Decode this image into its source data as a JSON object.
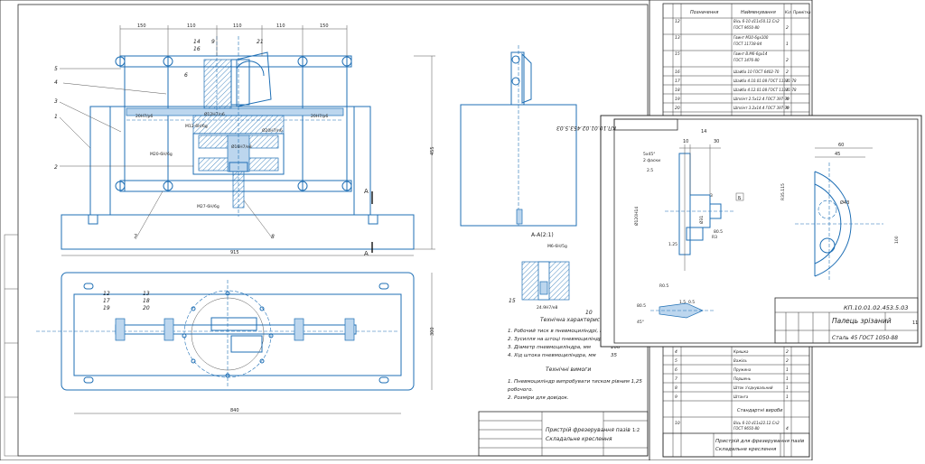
{
  "main_sheet": {
    "part_callouts": [
      "1",
      "2",
      "3",
      "4",
      "5",
      "6",
      "7",
      "8",
      "9",
      "14",
      "16",
      "21"
    ],
    "dimensions_top": [
      "150",
      "110",
      "110",
      "110",
      "150"
    ],
    "dimension_overall_width": "915",
    "dimension_bottom_width": "840",
    "dimension_height": "455",
    "dimension_plan_height": "300",
    "fit_labels": [
      "20H7/p6",
      "20H7/p6",
      "M12-6H/6g",
      "M20-6H/6g",
      "M27-6H/6g",
      "Ø12H7/n6",
      "Ø20H7/n6",
      "Ø16H7/e8"
    ],
    "plan_callouts": [
      "12",
      "17",
      "19",
      "13",
      "18",
      "20"
    ],
    "section_marker": "А",
    "section_title": "А-А(2:1)",
    "section_callouts": [
      "15",
      "10"
    ],
    "section_fits": [
      "М6-6Н/5g",
      "24.9Н7/e8"
    ],
    "tech_char_heading": "Технічна характеристика",
    "tech_char_items": [
      "1. Робочий тиск в пневмоциліндрі, МП",
      "2. Зусилля на штоці пневмоциліндра,",
      "3. Діаметр пневмоциліндра, мм",
      "4. Хід штока пневмоциліндра, мм"
    ],
    "tech_char_values": [
      "100",
      "35"
    ],
    "tech_req_heading": "Технічні вимоги",
    "tech_req_items": [
      "1. Пневмоциліндр випробувати тиском рівним 1,25",
      "   робочого.",
      "2. Розміри для довідок."
    ],
    "title_block": {
      "name_line1": "Пристрій фрезерування пазів",
      "name_line2": "Складальне креслення",
      "scale": "1:2"
    }
  },
  "spec_sheet": {
    "headers": [
      "Позначення",
      "Найменування",
      "Кіл.",
      "Примітка"
    ],
    "rows_top": [
      {
        "pos": "12",
        "name": "Вісь 6-10 d11х50.12.Cn2",
        "name2": "ГОСТ 9650-80",
        "qty": "2"
      },
      {
        "pos": "13",
        "name": "Гвинт М10-6gх100",
        "name2": "ГОСТ 11738-84",
        "qty": "1"
      },
      {
        "pos": "15",
        "name": "Гвинт В.М6-6gх14",
        "name2": "ГОСТ 1476-80",
        "qty": "2"
      },
      {
        "pos": "16",
        "name": "Шайба 10 ГОСТ 6402-70",
        "name2": "",
        "qty": "2"
      },
      {
        "pos": "17",
        "name": "Шайба 4.10.01.08 ГОСТ 11371-78",
        "name2": "",
        "qty": "4"
      },
      {
        "pos": "18",
        "name": "Шайба 4.12.01.08 ГОСТ 11371-78",
        "name2": "",
        "qty": "4"
      },
      {
        "pos": "19",
        "name": "Шплінт 2.5х12.4 ГОСТ 397-79",
        "name2": "",
        "qty": "4"
      },
      {
        "pos": "20",
        "name": "Шплінт 3.2х14.4 ГОСТ 397-79",
        "name2": "",
        "qty": "4"
      }
    ],
    "rows_bottom": [
      {
        "pos": "4",
        "name": "Кришка",
        "qty": "2"
      },
      {
        "pos": "5",
        "name": "Важіль",
        "qty": "2"
      },
      {
        "pos": "6",
        "name": "Пружина",
        "qty": "1"
      },
      {
        "pos": "7",
        "name": "Поршень",
        "qty": "1"
      },
      {
        "pos": "8",
        "name": "Шток з'єднувальний",
        "qty": "1"
      },
      {
        "pos": "9",
        "name": "Штанга",
        "qty": "1"
      }
    ],
    "section_std": "Стандартні вироби",
    "std_row": {
      "pos": "10",
      "name": "Вісь 6-10 d11х22.12.Cn2",
      "name2": "ГОСТ 9650-80",
      "qty": "4"
    },
    "title_block": {
      "name_line1": "Пристрій для фрезерування пазів",
      "name_line2": "Складальне креслення"
    }
  },
  "part_sheet": {
    "doc_code_rotated": "КП.10.01.02.453.5.03",
    "dims": [
      "14",
      "10",
      "30",
      "5х45°",
      "2 фаски",
      "Ø120Н14",
      "Ø31",
      "Ø60",
      "Ø40",
      "Ø43",
      "Ø25",
      "Ø42",
      "Ø25",
      "45",
      "60",
      "1.25",
      "2.5",
      "80.5",
      "3",
      "1.5",
      "0.5",
      "Ø4.9",
      "R0.5",
      "R3",
      "0.5х45°",
      "80.5",
      "45°",
      "R35.115",
      "100"
    ],
    "datum": "Б",
    "title_block": {
      "code": "КП.10.01.02.453.5.03",
      "name": "Палець зрізаний",
      "material": "Сталь 45 ГОСТ 1050-88",
      "sheet": "11"
    }
  }
}
